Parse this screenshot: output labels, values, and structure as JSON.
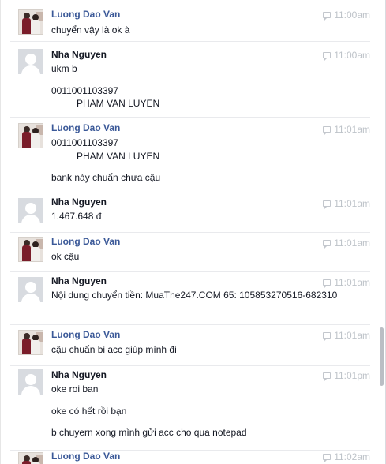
{
  "messages": [
    {
      "sender": "Luong Dao Van",
      "time": "11:00am",
      "lines": [
        "chuyển vậy là ok à"
      ]
    },
    {
      "sender": "Nha Nguyen",
      "time": "11:00am",
      "lines": [
        "ukm b",
        "0011001103397",
        "PHAM VAN LUYEN"
      ]
    },
    {
      "sender": "Luong Dao Van",
      "time": "11:01am",
      "lines": [
        "0011001103397",
        "PHAM VAN LUYEN",
        "bank này chuẩn chưa cậu"
      ]
    },
    {
      "sender": "Nha Nguyen",
      "time": "11:01am",
      "lines": [
        "1.467.648 đ"
      ]
    },
    {
      "sender": "Luong Dao Van",
      "time": "11:01am",
      "lines": [
        "ok cậu"
      ]
    },
    {
      "sender": "Nha Nguyen",
      "time": "11:01am",
      "lines": [
        "Nội dung chuyển tiền: MuaThe247.COM 65: 105853270516-682310"
      ]
    },
    {
      "sender": "Luong Dao Van",
      "time": "11:01am",
      "lines": [
        "cậu chuẩn bị acc giúp mình đi"
      ]
    },
    {
      "sender": "Nha Nguyen",
      "time": "11:01pm",
      "lines": [
        "oke roi ban",
        "oke có hết rồi bạn",
        "b chuyern xong mình gửi acc cho qua notepad"
      ]
    },
    {
      "sender": "Luong Dao Van",
      "time": "11:02am",
      "lines": []
    }
  ],
  "colors": {
    "sender_blue": "#3b5998",
    "text": "#141823",
    "timestamp": "#bec3c9"
  }
}
